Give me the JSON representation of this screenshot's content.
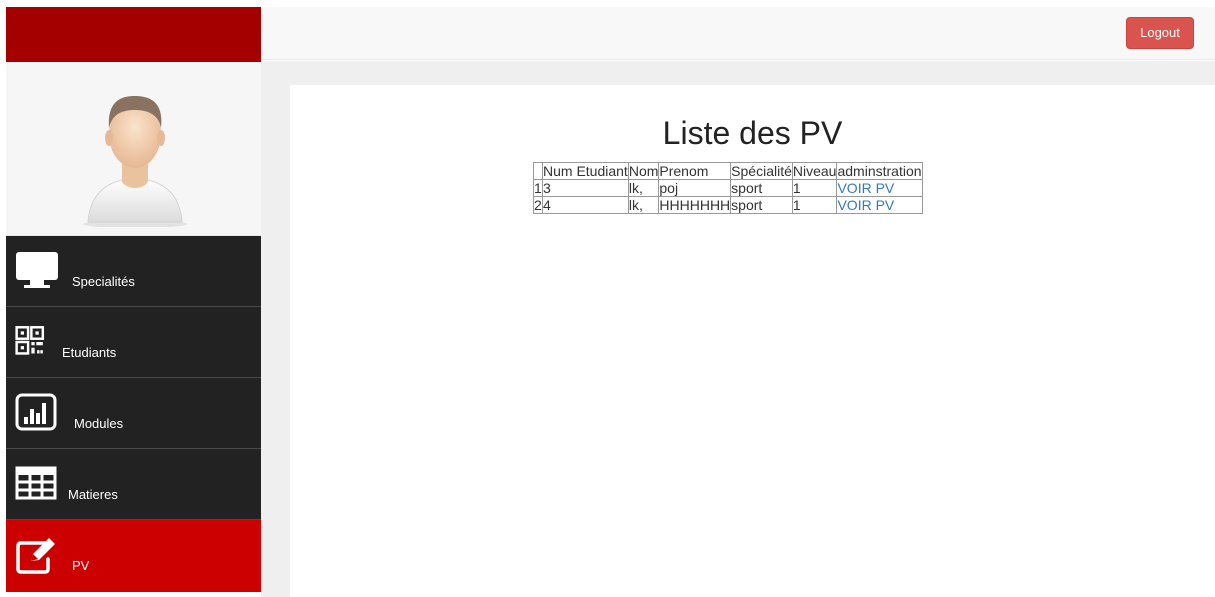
{
  "topbar": {
    "logout_label": "Logout"
  },
  "sidebar": {
    "items": [
      {
        "label": "Specialités",
        "icon": "monitor-icon"
      },
      {
        "label": "Etudiants",
        "icon": "qrcode-icon"
      },
      {
        "label": "Modules",
        "icon": "bar-chart-icon"
      },
      {
        "label": "Matieres",
        "icon": "table-grid-icon"
      },
      {
        "label": "PV",
        "icon": "edit-icon",
        "active": true
      }
    ]
  },
  "main": {
    "title": "Liste des PV",
    "table": {
      "headers": [
        "",
        "Num Etudiant",
        "Nom",
        "Prenom",
        "Spécialité",
        "Niveau",
        "adminstration"
      ],
      "rows": [
        {
          "index": "1",
          "num": "3",
          "nom": "lk,",
          "prenom": "poj",
          "specialite": "sport",
          "niveau": "1",
          "action": "VOIR PV"
        },
        {
          "index": "2",
          "num": "4",
          "nom": "lk,",
          "prenom": "HHHHHHH",
          "specialite": "sport",
          "niveau": "1",
          "action": "VOIR PV"
        }
      ]
    }
  },
  "colors": {
    "brand": "#a50000",
    "active": "#cc0000",
    "sidebar_bg": "#222222",
    "logout": "#d9534f",
    "link": "#337ab7"
  }
}
